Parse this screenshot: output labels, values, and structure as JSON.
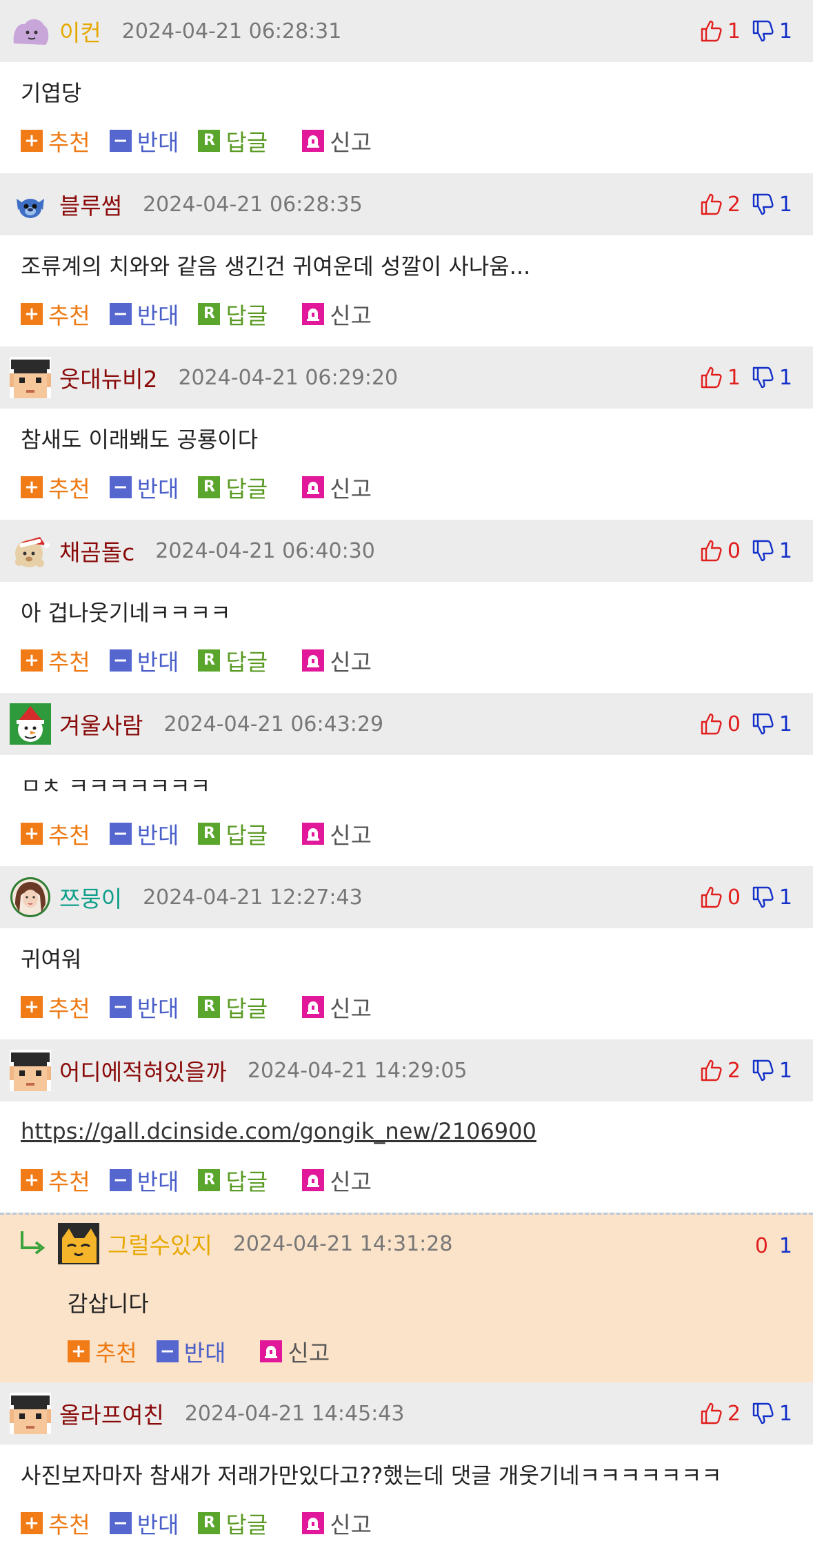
{
  "labels": {
    "recommend": "추천",
    "oppose": "반대",
    "reply": "답글",
    "report": "신고",
    "reply_letter": "R"
  },
  "colors": {
    "header_bg": "#ececec",
    "reply_bg": "#fbe3c9",
    "recommend": "#f07b17",
    "oppose": "#5566cf",
    "reply": "#5aa52c",
    "report": "#e2189a",
    "upvote": "#e0201e",
    "downvote": "#1330c8"
  },
  "comments": [
    {
      "nick": "이컨",
      "nick_color": "#e6a800",
      "date": "2024-04-21 06:28:31",
      "up": "1",
      "down": "1",
      "text": "기엽당",
      "avatar": "ditto-avatar-icon"
    },
    {
      "nick": "블루썸",
      "nick_color": "#8a0a0a",
      "date": "2024-04-21 06:28:35",
      "up": "2",
      "down": "1",
      "text": "조류계의 치와와 같음 생긴건 귀여운데 성깔이 사나움...",
      "avatar": "stitch-avatar-icon"
    },
    {
      "nick": "웃대뉴비2",
      "nick_color": "#8a0a0a",
      "date": "2024-04-21 06:29:20",
      "up": "1",
      "down": "1",
      "text": "참새도 이래봬도 공룡이다",
      "avatar": "pixel-face-avatar-icon"
    },
    {
      "nick": "채곰돌c",
      "nick_color": "#8a0a0a",
      "date": "2024-04-21 06:40:30",
      "up": "0",
      "down": "1",
      "text": "아 겁나웃기네ㅋㅋㅋㅋ",
      "avatar": "santa-bear-avatar-icon"
    },
    {
      "nick": "겨울사람",
      "nick_color": "#8a0a0a",
      "date": "2024-04-21 06:43:29",
      "up": "0",
      "down": "1",
      "text": "ㅁㅊ ㅋㅋㅋㅋㅋㅋㅋ",
      "avatar": "snowman-avatar-icon"
    },
    {
      "nick": "쯔뭉이",
      "nick_color": "#0f9e8a",
      "date": "2024-04-21 12:27:43",
      "up": "0",
      "down": "1",
      "text": "귀여워",
      "avatar": "portrait-avatar-icon"
    },
    {
      "nick": "어디에적혀있을까",
      "nick_color": "#8a0a0a",
      "date": "2024-04-21 14:29:05",
      "up": "2",
      "down": "1",
      "text": "https://gall.dcinside.com/gongik_new/2106900",
      "avatar": "pixel-face-avatar-icon"
    }
  ],
  "reply": {
    "nick": "그럴수있지",
    "nick_color": "#e6a800",
    "date": "2024-04-21 14:31:28",
    "up": "0",
    "down": "1",
    "text": "감삽니다",
    "avatar": "cat-avatar-icon"
  },
  "last": {
    "nick": "올라프여친",
    "nick_color": "#8a0a0a",
    "date": "2024-04-21 14:45:43",
    "up": "2",
    "down": "1",
    "text": "사진보자마자 참새가 저래가만있다고??했는데 댓글 개웃기네ㅋㅋㅋㅋㅋㅋㅋ",
    "avatar": "pixel-face-avatar-icon"
  }
}
